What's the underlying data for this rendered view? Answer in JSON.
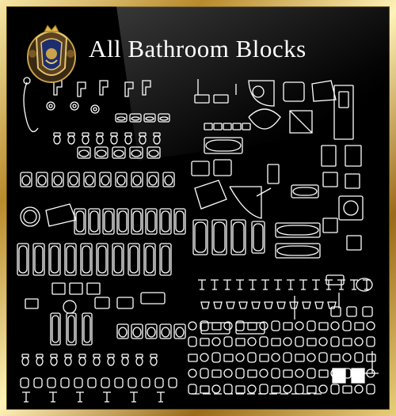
{
  "title": "All Bathroom Blocks",
  "colors": {
    "frame_gold": "#c9a24a",
    "background": "#000000",
    "line_art": "#ffffff",
    "logo_crest": "#5a4120"
  },
  "icons": [
    "crest-logo-icon",
    "bathroom-cad-blocks-icon"
  ]
}
